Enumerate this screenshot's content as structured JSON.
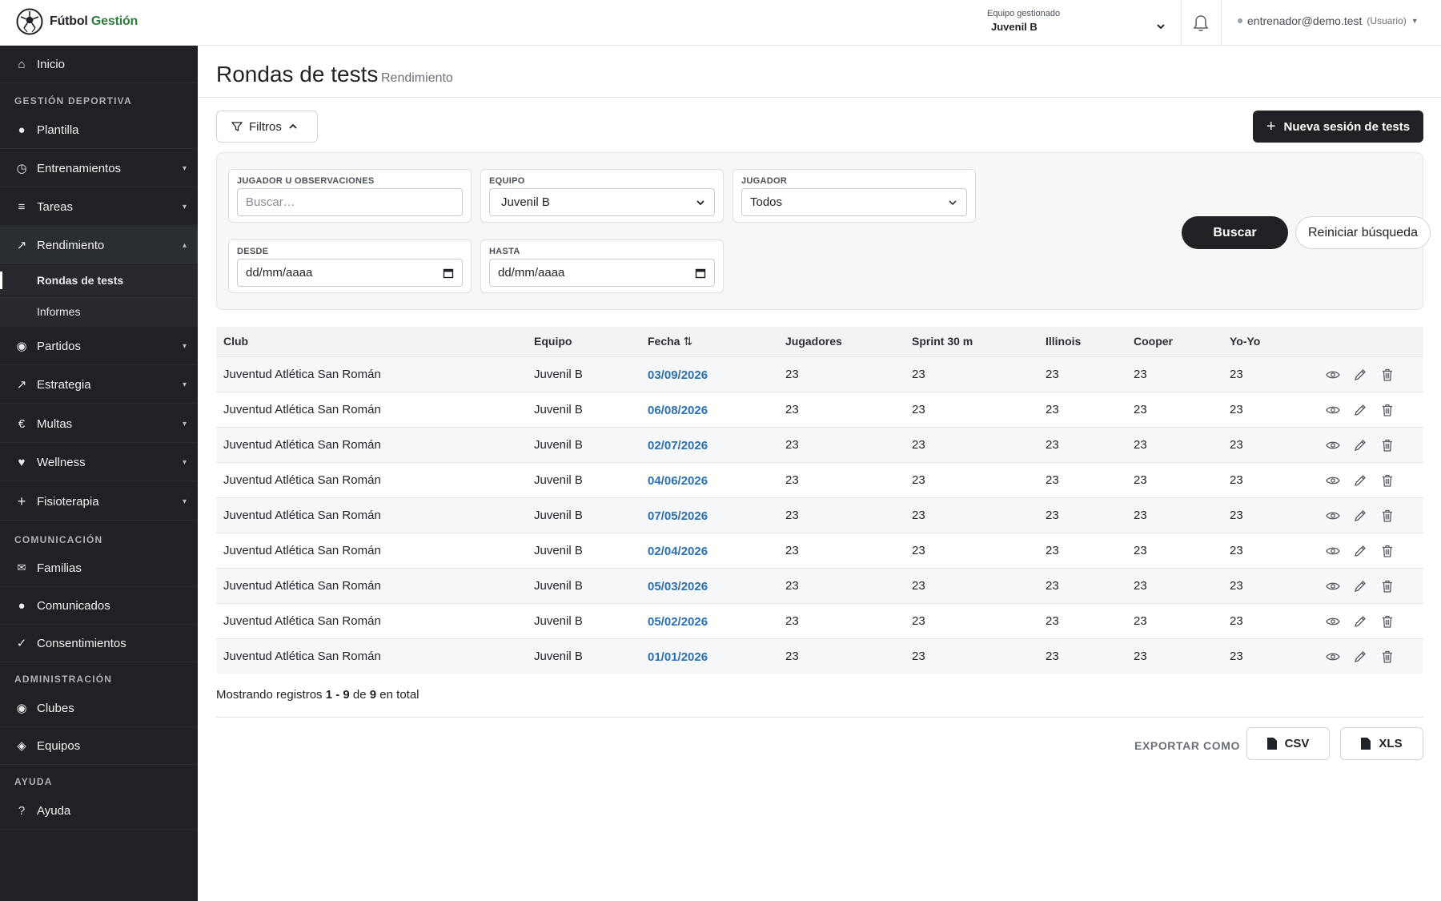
{
  "app": {
    "name_part1": "Fútbol",
    "name_part2": "Gestión"
  },
  "header": {
    "team_label": "Equipo gestionado",
    "team_value": "Juvenil B",
    "user_email": "entrenador@demo.test",
    "user_role": "(Usuario)"
  },
  "sidebar": {
    "inicio": "Inicio",
    "section_deportiva": "GESTIÓN DEPORTIVA",
    "plantilla": "Plantilla",
    "entrenamientos": "Entrenamientos",
    "tareas": "Tareas",
    "rendimiento": "Rendimiento",
    "rondas": "Rondas de tests",
    "informes": "Informes",
    "partidos": "Partidos",
    "estrategia": "Estrategia",
    "multas": "Multas",
    "wellness": "Wellness",
    "fisioterapia": "Fisioterapia",
    "section_comunicacion": "COMUNICACIÓN",
    "familias": "Familias",
    "comunicados": "Comunicados",
    "consentimientos": "Consentimientos",
    "section_admin": "ADMINISTRACIÓN",
    "clubes": "Clubes",
    "equipos": "Equipos",
    "section_ayuda": "AYUDA",
    "ayuda": "Ayuda"
  },
  "page": {
    "title": "Rondas de tests",
    "subtitle": "Rendimiento",
    "filters_button": "Filtros",
    "new_button": "Nueva sesión de tests"
  },
  "filters": {
    "q_label": "JUGADOR U OBSERVACIONES",
    "q_placeholder": "Buscar…",
    "team_label": "EQUIPO",
    "team_value": "Juvenil B",
    "player_label": "JUGADOR",
    "player_value": "Todos",
    "from_label": "DESDE",
    "from_value": "dd/mm/aaaa",
    "to_label": "HASTA",
    "to_value": "dd/mm/aaaa",
    "search_button": "Buscar",
    "reset_button": "Reiniciar búsqueda"
  },
  "table": {
    "headers": {
      "club": "Club",
      "equipo": "Equipo",
      "fecha": "Fecha",
      "jugadores": "Jugadores",
      "sprint": "Sprint 30 m",
      "illinois": "Illinois",
      "cooper": "Cooper",
      "yoyo": "Yo-Yo"
    },
    "rows": [
      {
        "club": "Juventud Atlética San Román",
        "equipo": "Juvenil B",
        "fecha": "03/09/2026",
        "jugadores": "23",
        "sprint": "23",
        "illinois": "23",
        "cooper": "23",
        "yoyo": "23"
      },
      {
        "club": "Juventud Atlética San Román",
        "equipo": "Juvenil B",
        "fecha": "06/08/2026",
        "jugadores": "23",
        "sprint": "23",
        "illinois": "23",
        "cooper": "23",
        "yoyo": "23"
      },
      {
        "club": "Juventud Atlética San Román",
        "equipo": "Juvenil B",
        "fecha": "02/07/2026",
        "jugadores": "23",
        "sprint": "23",
        "illinois": "23",
        "cooper": "23",
        "yoyo": "23"
      },
      {
        "club": "Juventud Atlética San Román",
        "equipo": "Juvenil B",
        "fecha": "04/06/2026",
        "jugadores": "23",
        "sprint": "23",
        "illinois": "23",
        "cooper": "23",
        "yoyo": "23"
      },
      {
        "club": "Juventud Atlética San Román",
        "equipo": "Juvenil B",
        "fecha": "07/05/2026",
        "jugadores": "23",
        "sprint": "23",
        "illinois": "23",
        "cooper": "23",
        "yoyo": "23"
      },
      {
        "club": "Juventud Atlética San Román",
        "equipo": "Juvenil B",
        "fecha": "02/04/2026",
        "jugadores": "23",
        "sprint": "23",
        "illinois": "23",
        "cooper": "23",
        "yoyo": "23"
      },
      {
        "club": "Juventud Atlética San Román",
        "equipo": "Juvenil B",
        "fecha": "05/03/2026",
        "jugadores": "23",
        "sprint": "23",
        "illinois": "23",
        "cooper": "23",
        "yoyo": "23"
      },
      {
        "club": "Juventud Atlética San Román",
        "equipo": "Juvenil B",
        "fecha": "05/02/2026",
        "jugadores": "23",
        "sprint": "23",
        "illinois": "23",
        "cooper": "23",
        "yoyo": "23"
      },
      {
        "club": "Juventud Atlética San Román",
        "equipo": "Juvenil B",
        "fecha": "01/01/2026",
        "jugadores": "23",
        "sprint": "23",
        "illinois": "23",
        "cooper": "23",
        "yoyo": "23"
      }
    ]
  },
  "summary": {
    "prefix": "Mostrando registros",
    "range": "1 - 9",
    "of": "de",
    "total": "9",
    "suffix": "en total"
  },
  "export": {
    "label": "EXPORTAR COMO",
    "csv": "CSV",
    "xls": "XLS"
  },
  "colors": {
    "sidebar_bg": "#1f2125",
    "accent_link": "#2a6fb3",
    "brand_green": "#2e7d3a",
    "primary_button": "#1f2125"
  }
}
